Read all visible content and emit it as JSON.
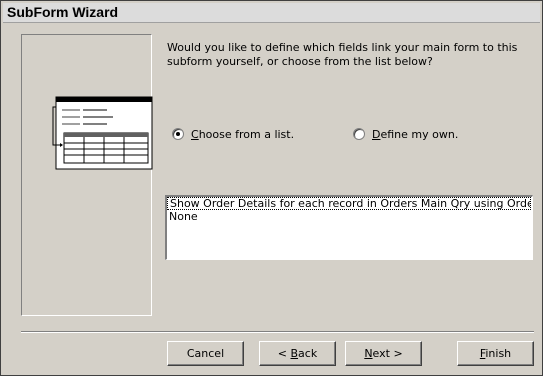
{
  "window": {
    "title": "SubForm Wizard"
  },
  "question": "Would you like to define which fields link your main form to this subform yourself, or choose from the list below?",
  "options": {
    "choose": {
      "label_pre": "",
      "accel": "C",
      "label_post": "hoose from a list.",
      "selected": true
    },
    "define": {
      "label_pre": "",
      "accel": "D",
      "label_post": "efine my own.",
      "selected": false
    }
  },
  "list": {
    "items": [
      "Show Order Details for each record in Orders Main Qry using OrderII",
      "None"
    ]
  },
  "buttons": {
    "cancel": {
      "pre": "Cancel",
      "accel": "",
      "post": ""
    },
    "back": {
      "pre": "< ",
      "accel": "B",
      "post": "ack"
    },
    "next": {
      "pre": "",
      "accel": "N",
      "post": "ext >"
    },
    "finish": {
      "pre": "",
      "accel": "F",
      "post": "inish"
    }
  },
  "icons": {
    "illustration": "subform-illustration-icon",
    "radio": "radio-icon"
  }
}
